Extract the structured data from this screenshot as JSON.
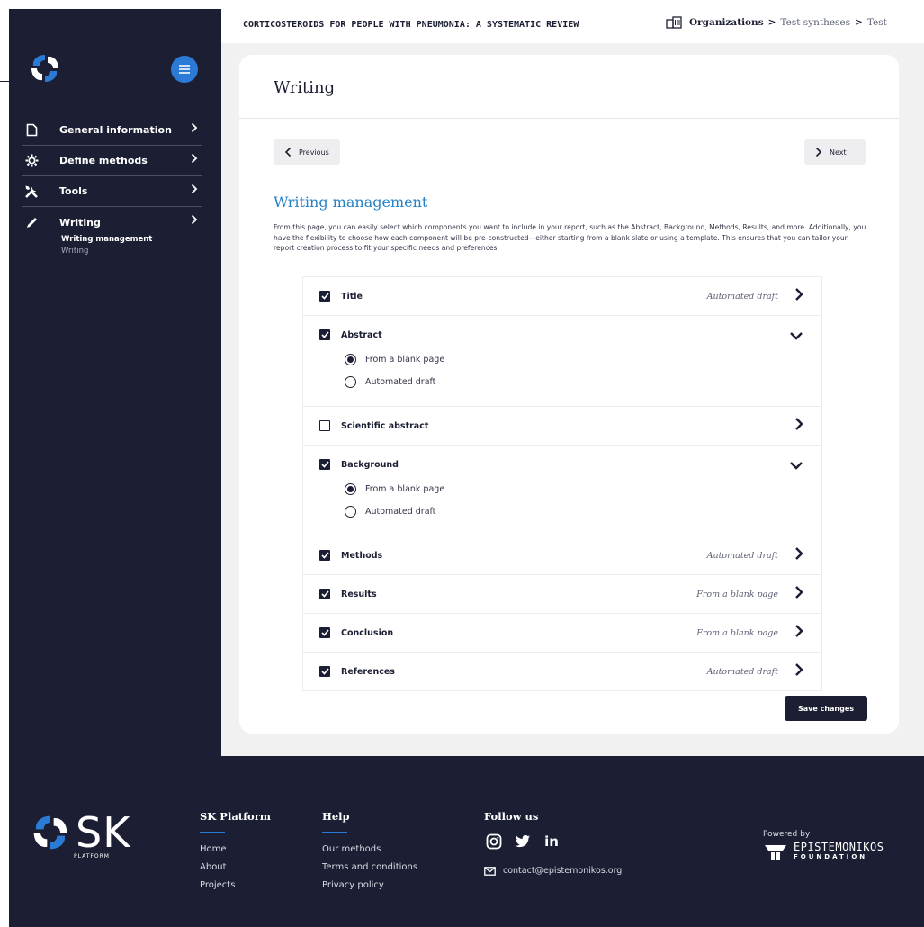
{
  "header": {
    "study_title": "CORTICOSTEROIDS FOR PEOPLE WITH PNEUMONIA: A SYSTEMATIC REVIEW",
    "breadcrumb": {
      "org": "Organizations",
      "item2": "Test syntheses",
      "item3": "Test"
    }
  },
  "sidebar": {
    "items": [
      {
        "label": "General information",
        "icon": "document-icon"
      },
      {
        "label": "Define methods",
        "icon": "gear-icon"
      },
      {
        "label": "Tools",
        "icon": "tools-icon"
      },
      {
        "label": "Writing",
        "icon": "pencil-icon"
      }
    ],
    "subitems": {
      "active": "Writing management",
      "other": "Writing"
    }
  },
  "page": {
    "title": "Writing",
    "prev_label": "Previous",
    "next_label": "Next",
    "section_title": "Writing management",
    "description": "From this page, you can easily select which components you want to include in your report, such as the Abstract, Background, Methods, Results, and more. Additionally, you have the flexibility to choose how each component will be pre-constructed—either starting from a blank slate or using a template. This ensures that you can tailor your report creation process to fit your specific needs and preferences",
    "save_label": "Save changes"
  },
  "components": [
    {
      "label": "Title",
      "checked": true,
      "value": "Automated draft",
      "expanded": false
    },
    {
      "label": "Abstract",
      "checked": true,
      "value": "",
      "expanded": true,
      "options": [
        {
          "label": "From a blank page",
          "selected": true
        },
        {
          "label": "Automated draft",
          "selected": false
        }
      ]
    },
    {
      "label": "Scientific abstract",
      "checked": false,
      "value": "",
      "expanded": false
    },
    {
      "label": "Background",
      "checked": true,
      "value": "",
      "expanded": true,
      "options": [
        {
          "label": "From a blank page",
          "selected": true
        },
        {
          "label": "Automated draft",
          "selected": false
        }
      ]
    },
    {
      "label": "Methods",
      "checked": true,
      "value": "Automated draft",
      "expanded": false
    },
    {
      "label": "Results",
      "checked": true,
      "value": "From a blank page",
      "expanded": false
    },
    {
      "label": "Conclusion",
      "checked": true,
      "value": "From a blank page",
      "expanded": false
    },
    {
      "label": "References",
      "checked": true,
      "value": "Automated draft",
      "expanded": false
    }
  ],
  "footer": {
    "brand": "SK",
    "brand_sub": "PLATFORM",
    "col1": {
      "title": "SK Platform",
      "links": [
        "Home",
        "About",
        "Projects"
      ]
    },
    "col2": {
      "title": "Help",
      "links": [
        "Our methods",
        "Terms and conditions",
        "Privacy policy"
      ]
    },
    "col3": {
      "title": "Follow us",
      "social": [
        "instagram-icon",
        "twitter-icon",
        "linkedin-icon"
      ],
      "linkedin_text": "in",
      "email": "contact@epistemonikos.org"
    },
    "powered_by": "Powered by",
    "foundation_line1": "EPISTEMONIKOS",
    "foundation_line2": "FOUNDATION"
  },
  "colors": {
    "navy": "#1c1f33",
    "accent_blue": "#2583c6",
    "background_gray": "#f1f1f2"
  }
}
